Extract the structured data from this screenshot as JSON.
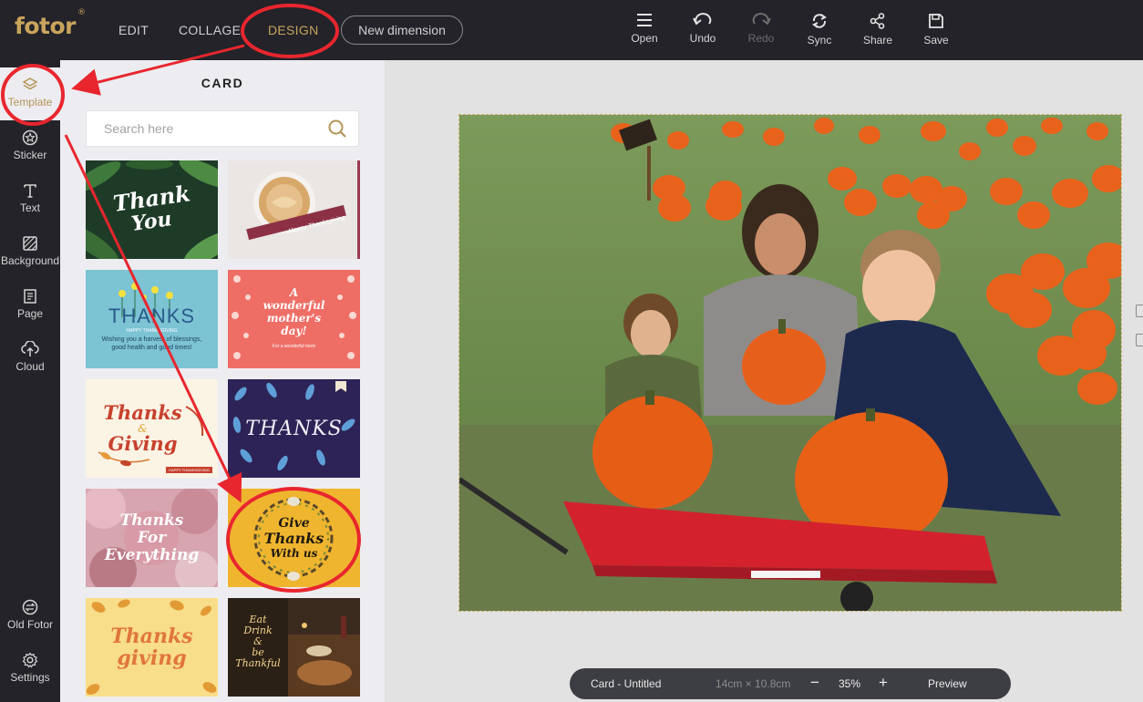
{
  "app": {
    "brand": "fotor",
    "registered_mark": "®"
  },
  "nav": {
    "edit": "EDIT",
    "collage": "COLLAGE",
    "design": "DESIGN",
    "new_dimension": "New dimension"
  },
  "toolbar": {
    "open": "Open",
    "undo": "Undo",
    "redo": "Redo",
    "sync": "Sync",
    "share": "Share",
    "save": "Save"
  },
  "sidebar": {
    "template": "Template",
    "sticker": "Sticker",
    "text": "Text",
    "background": "Background",
    "page": "Page",
    "cloud": "Cloud",
    "old_fotor": "Old Fotor",
    "settings": "Settings"
  },
  "panel": {
    "title": "CARD",
    "search_placeholder": "Search here",
    "templates": [
      {
        "line1": "Thank",
        "line2": "You"
      },
      {
        "line1": "Happy Thanksgiving"
      },
      {
        "line1": "THANKS",
        "line2": "HAPPY THANKSGIVING",
        "line3": "Wishing you a harvest of blessings,",
        "line4": "good health and good times!"
      },
      {
        "line1": "A",
        "line2": "wonderful",
        "line3": "mother's",
        "line4": "day!",
        "line5": "For a wonderful mom"
      },
      {
        "line1": "Thanks",
        "line2": "&",
        "line3": "Giving",
        "line4": "HAPPY THANKSGIVING"
      },
      {
        "line1": "THANKS"
      },
      {
        "line1": "Thanks",
        "line2": "For",
        "line3": "Everything"
      },
      {
        "line1": "Give",
        "line2": "Thanks",
        "line3": "With us"
      },
      {
        "line1": "Thanks",
        "line2": "giving"
      },
      {
        "line1": "Eat",
        "line2": "Drink",
        "line3": "&",
        "line4": "be",
        "line5": "Thankful"
      }
    ]
  },
  "status": {
    "doc_name": "Card - Untitled",
    "dimensions": "14cm × 10.8cm",
    "minus": "−",
    "zoom": "35%",
    "plus": "+",
    "preview": "Preview"
  },
  "colors": {
    "accent": "#c9a45c",
    "topbar": "#232329",
    "annotation": "#e8262e"
  }
}
